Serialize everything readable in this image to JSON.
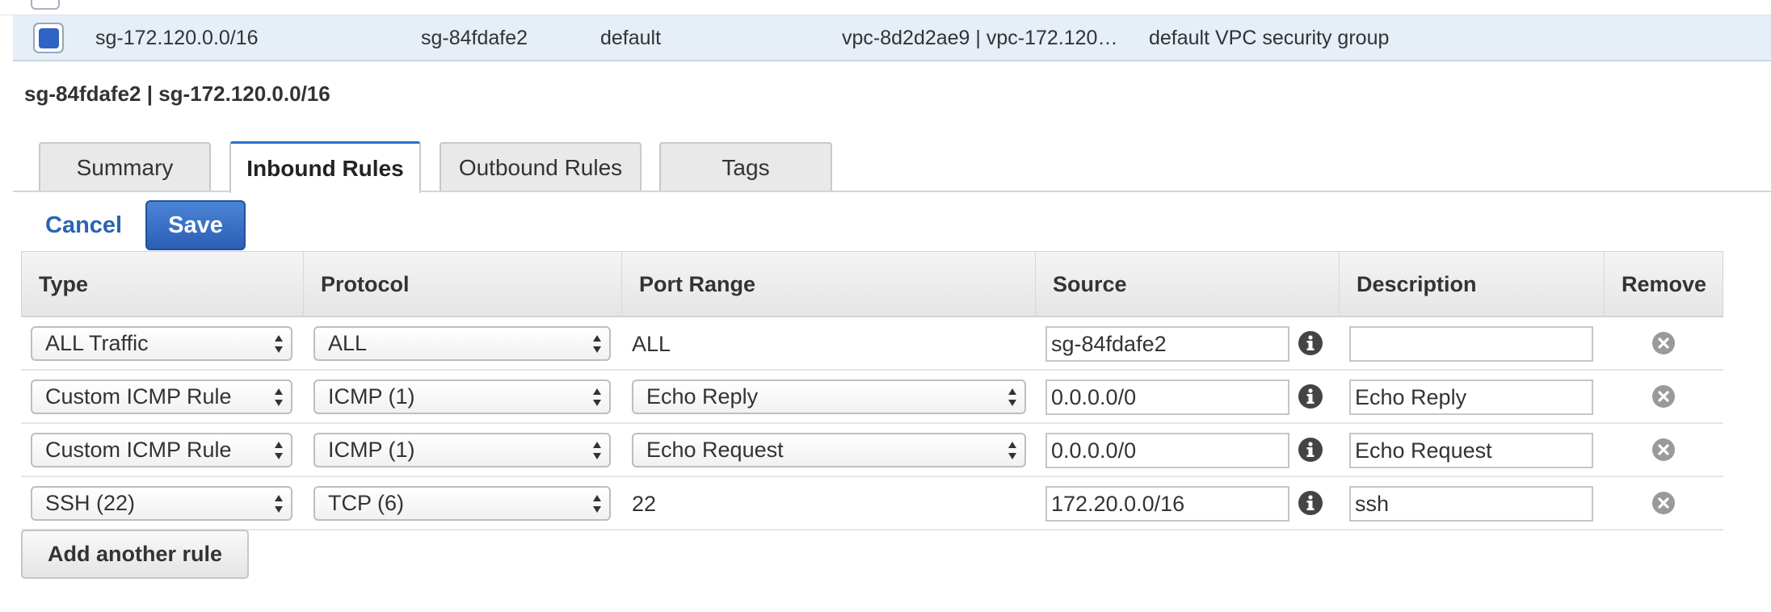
{
  "selected_row": {
    "name": "sg-172.120.0.0/16",
    "group_id": "sg-84fdafe2",
    "group_name": "default",
    "vpc_id": "vpc-8d2d2ae9 | vpc-172.120…",
    "description": "default VPC security group"
  },
  "detail": {
    "title": "sg-84fdafe2 | sg-172.120.0.0/16"
  },
  "tabs": [
    {
      "label": "Summary"
    },
    {
      "label": "Inbound Rules"
    },
    {
      "label": "Outbound Rules"
    },
    {
      "label": "Tags"
    }
  ],
  "active_tab": "Inbound Rules",
  "actions": {
    "cancel": "Cancel",
    "save": "Save",
    "add_rule": "Add another rule"
  },
  "table": {
    "columns": [
      "Type",
      "Protocol",
      "Port Range",
      "Source",
      "Description",
      "Remove"
    ],
    "rows": [
      {
        "type": "ALL Traffic",
        "protocol": "ALL",
        "port_range": "ALL",
        "source": "sg-84fdafe2",
        "description": ""
      },
      {
        "type": "Custom ICMP Rule",
        "protocol": "ICMP (1)",
        "port_range": "Echo Reply",
        "source": "0.0.0.0/0",
        "description": "Echo Reply"
      },
      {
        "type": "Custom ICMP Rule",
        "protocol": "ICMP (1)",
        "port_range": "Echo Request",
        "source": "0.0.0.0/0",
        "description": "Echo Request"
      },
      {
        "type": "SSH (22)",
        "protocol": "TCP (6)",
        "port_range": "22",
        "source": "172.20.0.0/16",
        "description": "ssh"
      }
    ]
  },
  "colors": {
    "accent": "#2b6fc7",
    "save_button": "#3a70c6",
    "selected_row_bg": "#e6eef8",
    "link": "#2a64b1"
  },
  "icons": {
    "info": "info-circle-icon",
    "remove": "remove-circle-x-icon",
    "select_arrows": "updown-arrows-icon"
  }
}
